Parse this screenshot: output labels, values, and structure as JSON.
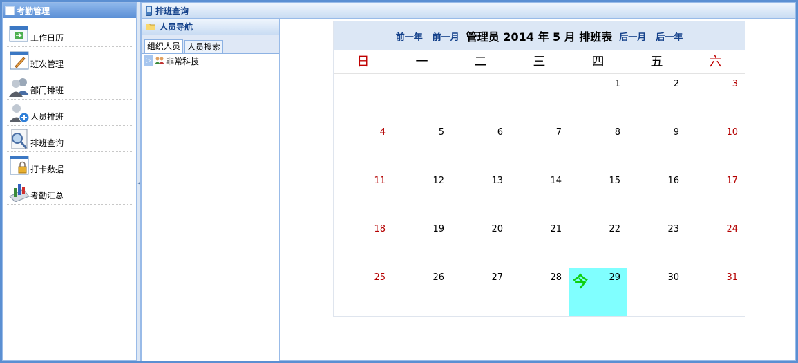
{
  "left_panel": {
    "title": "考勤管理",
    "items": [
      {
        "label": "工作日历",
        "icon": "calendar-icon"
      },
      {
        "label": "班次管理",
        "icon": "pencil-doc-icon"
      },
      {
        "label": "部门排班",
        "icon": "group-users-icon"
      },
      {
        "label": "人员排班",
        "icon": "user-add-icon"
      },
      {
        "label": "排班查询",
        "icon": "search-doc-icon"
      },
      {
        "label": "打卡数据",
        "icon": "lock-doc-icon"
      },
      {
        "label": "考勤汇总",
        "icon": "chart-icon"
      }
    ]
  },
  "main": {
    "title": "排班查询"
  },
  "nav": {
    "title": "人员导航",
    "tabs": [
      {
        "label": "组织人员"
      },
      {
        "label": "人员搜索"
      }
    ],
    "tree": {
      "root_label": "非常科技"
    }
  },
  "calendar": {
    "prev_year": "前一年",
    "prev_month": "前一月",
    "title": "管理员 2014 年 5 月 排班表",
    "next_month": "后一月",
    "next_year": "后一年",
    "weekdays": [
      "日",
      "一",
      "二",
      "三",
      "四",
      "五",
      "六"
    ],
    "weeks": [
      [
        "",
        "",
        "",
        "",
        "1",
        "2",
        "3"
      ],
      [
        "4",
        "5",
        "6",
        "7",
        "8",
        "9",
        "10"
      ],
      [
        "11",
        "12",
        "13",
        "14",
        "15",
        "16",
        "17"
      ],
      [
        "18",
        "19",
        "20",
        "21",
        "22",
        "23",
        "24"
      ],
      [
        "25",
        "26",
        "27",
        "28",
        "29",
        "30",
        "31"
      ]
    ],
    "today_label": "今",
    "today_day": "29",
    "colors": {
      "weekend": "#c00000",
      "today_bg": "#80ffff",
      "today_mark": "#10d010",
      "header_bg": "#dce7f5"
    }
  }
}
